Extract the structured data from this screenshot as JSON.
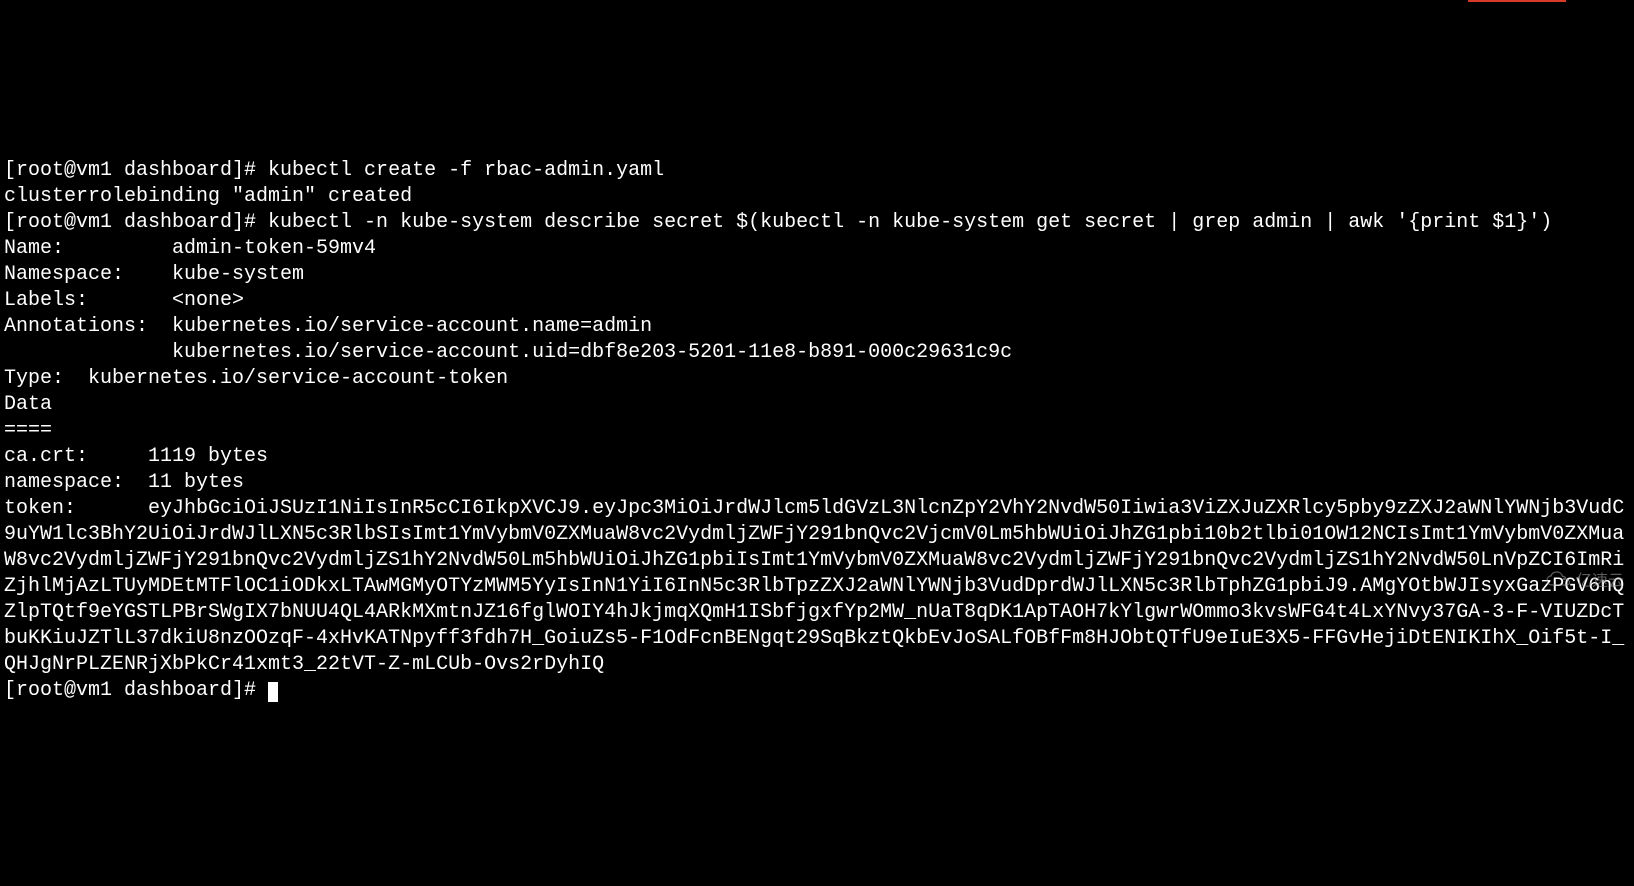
{
  "terminal": {
    "lines": [
      "[root@vm1 dashboard]# kubectl create -f rbac-admin.yaml",
      "clusterrolebinding \"admin\" created",
      "[root@vm1 dashboard]# kubectl -n kube-system describe secret $(kubectl -n kube-system get secret | grep admin | awk '{print $1}')",
      "Name:         admin-token-59mv4",
      "Namespace:    kube-system",
      "Labels:       <none>",
      "Annotations:  kubernetes.io/service-account.name=admin",
      "              kubernetes.io/service-account.uid=dbf8e203-5201-11e8-b891-000c29631c9c",
      "",
      "Type:  kubernetes.io/service-account-token",
      "",
      "Data",
      "====",
      "ca.crt:     1119 bytes",
      "namespace:  11 bytes",
      "token:      eyJhbGciOiJSUzI1NiIsInR5cCI6IkpXVCJ9.eyJpc3MiOiJrdWJlcm5ldGVzL3NlcnZpY2VhY2NvdW50Iiwia3ViZXJuZXRlcy5pby9zZXJ2aWNlYWNjb3VudC9uYW1lc3BhY2UiOiJrdWJlLXN5c3RlbSIsImt1YmVybmV0ZXMuaW8vc2VydmljZWFjY291bnQvc2VjcmV0Lm5hbWUiOiJhZG1pbi10b2tlbi01OW12NCIsImt1YmVybmV0ZXMuaW8vc2VydmljZWFjY291bnQvc2VydmljZS1hY2NvdW50Lm5hbWUiOiJhZG1pbiIsImt1YmVybmV0ZXMuaW8vc2VydmljZWFjY291bnQvc2VydmljZS1hY2NvdW50LnVpZCI6ImRiZjhlMjAzLTUyMDEtMTFlOC1iODkxLTAwMGMyOTYzMWM5YyIsInN1YiI6InN5c3RlbTpzZXJ2aWNlYWNjb3VudDprdWJlLXN5c3RlbTphZG1pbiJ9.AMgYOtbWJIsyxGazPGV6nQZlpTQtf9eYGSTLPBrSWgIX7bNUU4QL4ARkMXmtnJZ16fglWOIY4hJkjmqXQmH1ISbfjgxfYp2MW_nUaT8qDK1ApTAOH7kYlgwrWOmmo3kvsWFG4t4LxYNvy37GA-3-F-VIUZDcTbuKKiuJZTlL37dkiU8nzOOzqF-4xHvKATNpyff3fdh7H_GoiuZs5-F1OdFcnBENgqt29SqBkztQkbEvJoSALfOBfFm8HJObtQTfU9eIuE3X5-FFGvHejiDtENIKIhX_Oif5t-I_QHJgNrPLZENRjXbPkCr41xmt3_22tVT-Z-mLCUb-Ovs2rDyhIQ"
    ],
    "prompt_end": "[root@vm1 dashboard]# "
  },
  "watermark": {
    "text": "亿速云"
  }
}
